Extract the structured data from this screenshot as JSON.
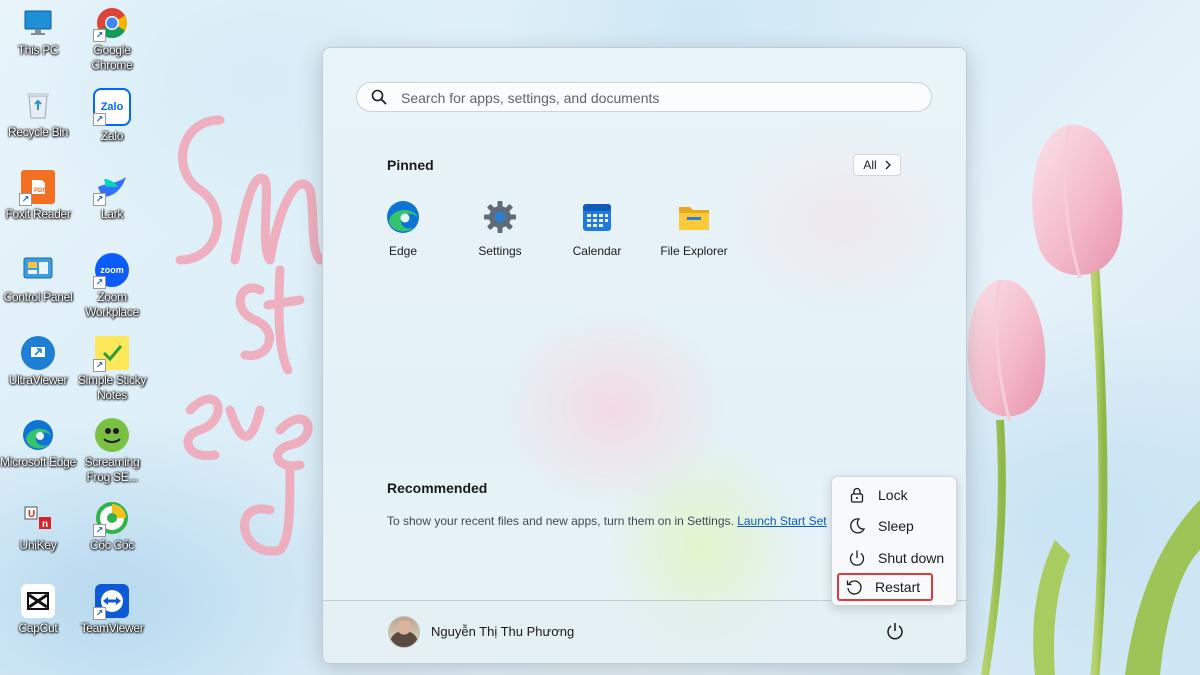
{
  "desktop": {
    "icons": [
      {
        "label": "This PC"
      },
      {
        "label": "Google Chrome"
      },
      {
        "label": "Recycle Bin"
      },
      {
        "label": "Zalo"
      },
      {
        "label": "Foxit Reader"
      },
      {
        "label": "Lark"
      },
      {
        "label": "Control Panel"
      },
      {
        "label": "Zoom Workplace"
      },
      {
        "label": "UltraViewer"
      },
      {
        "label": "Simple Sticky Notes"
      },
      {
        "label": "Microsoft Edge"
      },
      {
        "label": "Screaming Frog SE..."
      },
      {
        "label": "UniKey"
      },
      {
        "label": "Cốc Cốc"
      },
      {
        "label": "CapCut"
      },
      {
        "label": "TeamViewer"
      }
    ]
  },
  "start_menu": {
    "search": {
      "placeholder": "Search for apps, settings, and documents"
    },
    "pinned": {
      "title": "Pinned",
      "all_label": "All",
      "apps": [
        {
          "label": "Edge",
          "icon": "edge-icon"
        },
        {
          "label": "Settings",
          "icon": "gear-icon"
        },
        {
          "label": "Calendar",
          "icon": "calendar-icon"
        },
        {
          "label": "File Explorer",
          "icon": "folder-icon"
        }
      ]
    },
    "recommended": {
      "title": "Recommended",
      "text": "To show your recent files and new apps, turn them on in Settings.",
      "link": "Launch Start Set"
    },
    "user": {
      "name": "Nguyễn Thị Thu Phương"
    }
  },
  "power_menu": {
    "items": [
      {
        "label": "Lock",
        "icon": "lock-icon"
      },
      {
        "label": "Sleep",
        "icon": "moon-icon"
      },
      {
        "label": "Shut down",
        "icon": "power-icon"
      },
      {
        "label": "Restart",
        "icon": "restart-icon"
      }
    ],
    "highlight_color": "#e0393e"
  }
}
